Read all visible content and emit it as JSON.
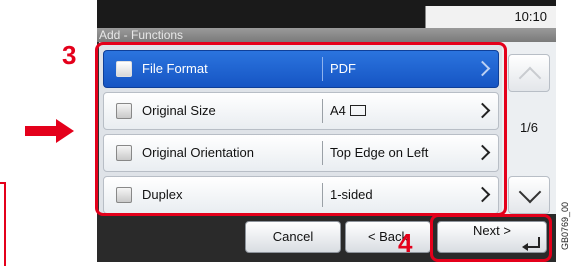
{
  "statusbar": {
    "time": "10:10"
  },
  "screen": {
    "title": "Add - Functions"
  },
  "function_list": {
    "rows": [
      {
        "label": "File Format",
        "value": "PDF",
        "selected": true
      },
      {
        "label": "Original Size",
        "value": "A4",
        "value_icon": "paper-portrait-icon",
        "selected": false
      },
      {
        "label": "Original Orientation",
        "value": "Top Edge on Left",
        "selected": false
      },
      {
        "label": "Duplex",
        "value": "1-sided",
        "selected": false
      }
    ]
  },
  "scroll": {
    "page_indicator": "1/6"
  },
  "bottom_bar": {
    "cancel_label": "Cancel",
    "back_label": "< Back",
    "next_label": "Next >"
  },
  "annotations": {
    "step_3": "3",
    "step_4": "4",
    "highlight_color": "#e4001b"
  },
  "figure_code": "GB0769_00"
}
